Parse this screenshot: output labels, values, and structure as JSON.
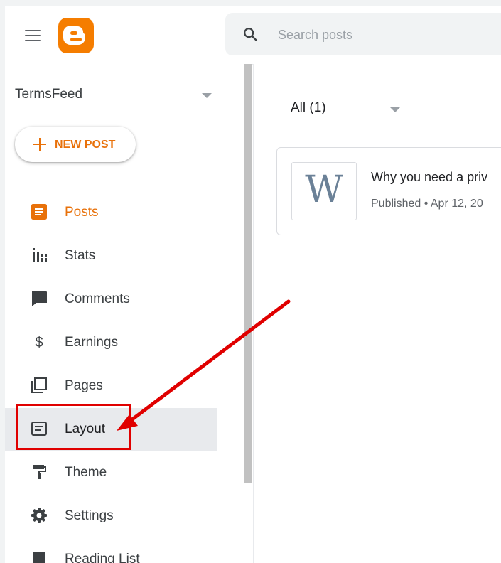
{
  "header": {
    "menu_icon": "hamburger-menu-icon",
    "logo_icon": "blogger-logo-icon",
    "brand_color": "#f57d00",
    "search": {
      "placeholder": "Search posts",
      "value": ""
    }
  },
  "sidebar": {
    "blog_name": "TermsFeed",
    "new_post_label": "NEW POST",
    "items": [
      {
        "label": "Posts",
        "icon": "posts-icon",
        "active": true
      },
      {
        "label": "Stats",
        "icon": "stats-icon"
      },
      {
        "label": "Comments",
        "icon": "comments-icon"
      },
      {
        "label": "Earnings",
        "icon": "dollar-icon"
      },
      {
        "label": "Pages",
        "icon": "pages-icon"
      },
      {
        "label": "Layout",
        "icon": "layout-icon",
        "selected": true
      },
      {
        "label": "Theme",
        "icon": "paint-roller-icon"
      },
      {
        "label": "Settings",
        "icon": "gear-icon"
      },
      {
        "label": "Reading List",
        "icon": "bookmark-icon"
      }
    ]
  },
  "main": {
    "filter_label": "All (1)",
    "posts": [
      {
        "thumbnail_letter": "W",
        "title": "Why you need a priv",
        "meta": "Published • Apr 12, 20"
      }
    ]
  },
  "annotation": {
    "color": "#e00000",
    "target": "Layout"
  }
}
